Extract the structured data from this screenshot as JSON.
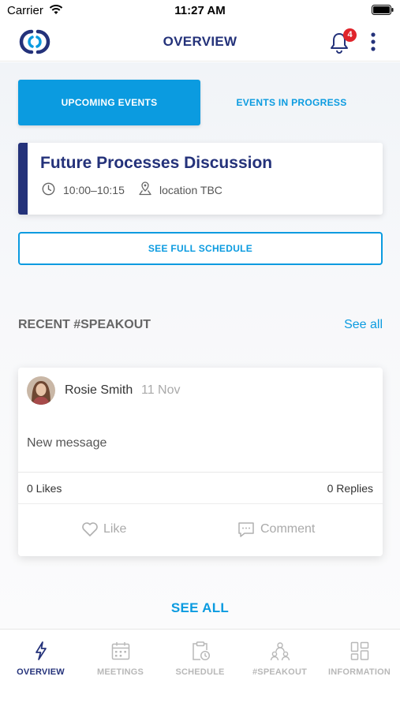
{
  "status_bar": {
    "carrier": "Carrier",
    "time": "11:27 AM"
  },
  "header": {
    "title": "OVERVIEW",
    "notification_count": "4"
  },
  "tabs": [
    {
      "label": "UPCOMING EVENTS",
      "active": true
    },
    {
      "label": "EVENTS IN PROGRESS",
      "active": false
    }
  ],
  "event": {
    "title": "Future Processes Discussion",
    "time": "10:00–10:15",
    "location": "location TBC"
  },
  "schedule_button": {
    "label": "SEE FULL SCHEDULE"
  },
  "speakout": {
    "section_title": "RECENT #SPEAKOUT",
    "see_all_label": "See all",
    "post": {
      "author": "Rosie Smith",
      "date": "11 Nov",
      "message": "New message",
      "likes": "0 Likes",
      "replies": "0 Replies",
      "like_label": "Like",
      "comment_label": "Comment"
    },
    "see_all_bottom": "SEE ALL"
  },
  "bottom_nav": {
    "items": [
      {
        "label": "OVERVIEW",
        "icon": "lightning-icon",
        "active": true
      },
      {
        "label": "MEETINGS",
        "icon": "calendar-icon",
        "active": false
      },
      {
        "label": "SCHEDULE",
        "icon": "clipboard-clock-icon",
        "active": false
      },
      {
        "label": "#SPEAKOUT",
        "icon": "people-icon",
        "active": false
      },
      {
        "label": "INFORMATION",
        "icon": "grid-icon",
        "active": false
      }
    ]
  },
  "colors": {
    "brand_navy": "#24327a",
    "accent_blue": "#0b9be0",
    "badge_red": "#e0242b",
    "inactive_gray": "#b8b8b8"
  }
}
